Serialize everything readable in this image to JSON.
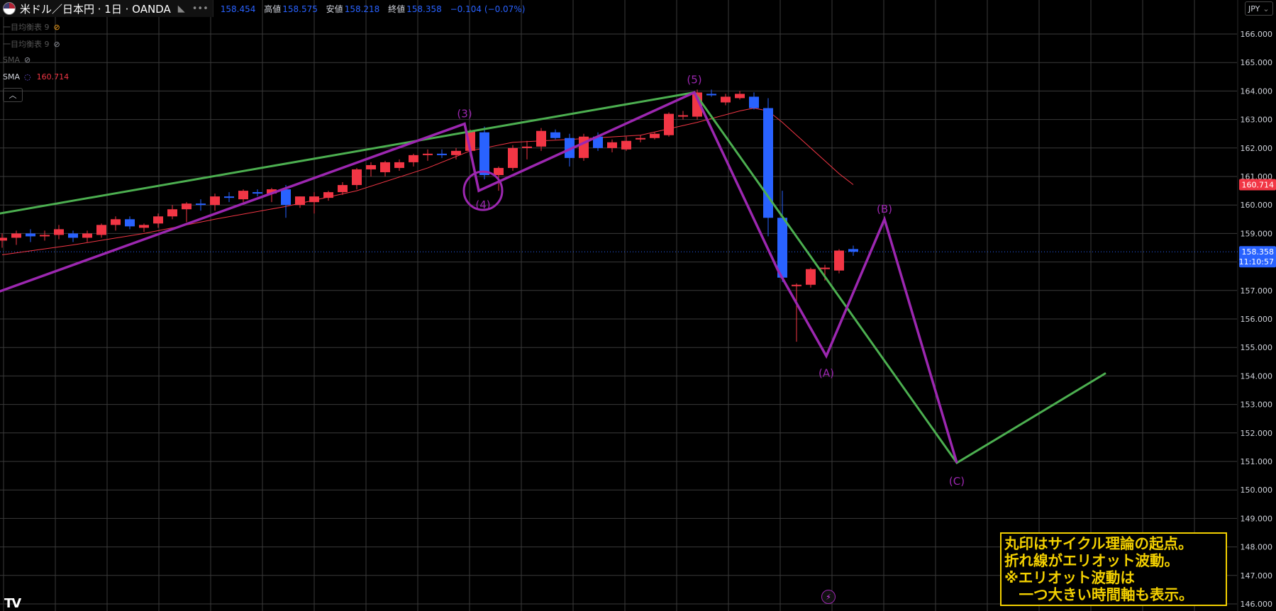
{
  "header": {
    "symbol": "米ドル／日本円 · 1日 · OANDA",
    "ohlc": [
      {
        "key": "",
        "value": "158.454"
      },
      {
        "key": "高値",
        "value": "158.575"
      },
      {
        "key": "安値",
        "value": "158.218"
      },
      {
        "key": "終値",
        "value": "158.358"
      },
      {
        "key": "",
        "value": "−0.104 (−0.07%)"
      }
    ],
    "currency_button": "JPY"
  },
  "indicators": [
    {
      "name": "一目均衡表 9",
      "value": "",
      "color": "#f7a21b",
      "visible": false
    },
    {
      "name": "一目均衡表 9",
      "value": "",
      "color": "#9598a1",
      "visible": false
    },
    {
      "name": "SMA",
      "value": "",
      "color": "#9598a1",
      "visible": false
    },
    {
      "name": "SMA",
      "value": "160.714",
      "color": "#f23645",
      "visible": true
    }
  ],
  "note": {
    "lines": [
      "丸印はサイクル理論の起点。",
      "折れ線がエリオット波動。",
      "※エリオット波動は",
      "　一つ大きい時間軸も表示。"
    ]
  },
  "colors": {
    "up": "#f23645",
    "down": "#2962ff",
    "elliott": "#9c27b0",
    "trend": "#4caf50",
    "sma": "#f23645",
    "note": "#f3d000"
  },
  "chart_data": {
    "type": "candlestick",
    "title": "米ドル／日本円 · 1日 · OANDA",
    "ylim": [
      146.0,
      166.0
    ],
    "y_ticks": [
      "166.000",
      "165.000",
      "164.000",
      "163.000",
      "162.000",
      "161.000",
      "160.000",
      "159.000",
      "158.000",
      "157.000",
      "156.000",
      "155.000",
      "154.000",
      "153.000",
      "152.000",
      "151.000",
      "150.000",
      "149.000",
      "148.000",
      "147.000",
      "146.000"
    ],
    "price_labels": [
      {
        "text": "160.714",
        "value": 160.714,
        "color": "#f23645"
      },
      {
        "text": "158.358",
        "value": 158.358,
        "color": "#2962ff",
        "sub": "11:10:57"
      }
    ],
    "candles": [
      {
        "x": 0,
        "o": 158.75,
        "h": 159.0,
        "l": 158.5,
        "c": 158.85
      },
      {
        "x": 1,
        "o": 158.85,
        "h": 159.1,
        "l": 158.6,
        "c": 159.0
      },
      {
        "x": 2,
        "o": 159.0,
        "h": 159.15,
        "l": 158.7,
        "c": 158.9
      },
      {
        "x": 3,
        "o": 158.9,
        "h": 159.1,
        "l": 158.75,
        "c": 158.95
      },
      {
        "x": 4,
        "o": 158.95,
        "h": 159.3,
        "l": 158.8,
        "c": 159.15
      },
      {
        "x": 5,
        "o": 159.0,
        "h": 159.1,
        "l": 158.7,
        "c": 158.85
      },
      {
        "x": 6,
        "o": 158.85,
        "h": 159.1,
        "l": 158.7,
        "c": 159.0
      },
      {
        "x": 7,
        "o": 158.95,
        "h": 159.35,
        "l": 158.85,
        "c": 159.3
      },
      {
        "x": 8,
        "o": 159.3,
        "h": 159.6,
        "l": 159.1,
        "c": 159.5
      },
      {
        "x": 9,
        "o": 159.5,
        "h": 159.6,
        "l": 159.15,
        "c": 159.25
      },
      {
        "x": 10,
        "o": 159.2,
        "h": 159.35,
        "l": 159.05,
        "c": 159.3
      },
      {
        "x": 11,
        "o": 159.35,
        "h": 159.7,
        "l": 159.2,
        "c": 159.6
      },
      {
        "x": 12,
        "o": 159.6,
        "h": 160.0,
        "l": 159.5,
        "c": 159.85
      },
      {
        "x": 13,
        "o": 159.85,
        "h": 160.1,
        "l": 159.4,
        "c": 160.05
      },
      {
        "x": 14,
        "o": 160.05,
        "h": 160.2,
        "l": 159.8,
        "c": 160.0
      },
      {
        "x": 15,
        "o": 160.0,
        "h": 160.4,
        "l": 159.8,
        "c": 160.3
      },
      {
        "x": 16,
        "o": 160.3,
        "h": 160.45,
        "l": 160.1,
        "c": 160.25
      },
      {
        "x": 17,
        "o": 160.2,
        "h": 160.55,
        "l": 160.1,
        "c": 160.5
      },
      {
        "x": 18,
        "o": 160.45,
        "h": 160.55,
        "l": 160.3,
        "c": 160.4
      },
      {
        "x": 19,
        "o": 160.4,
        "h": 160.6,
        "l": 160.1,
        "c": 160.55
      },
      {
        "x": 20,
        "o": 160.55,
        "h": 160.7,
        "l": 159.55,
        "c": 160.0
      },
      {
        "x": 21,
        "o": 160.0,
        "h": 160.3,
        "l": 159.9,
        "c": 160.3
      },
      {
        "x": 22,
        "o": 160.1,
        "h": 160.45,
        "l": 159.7,
        "c": 160.3
      },
      {
        "x": 23,
        "o": 160.25,
        "h": 160.5,
        "l": 160.15,
        "c": 160.45
      },
      {
        "x": 24,
        "o": 160.45,
        "h": 160.8,
        "l": 160.35,
        "c": 160.7
      },
      {
        "x": 25,
        "o": 160.7,
        "h": 161.3,
        "l": 160.55,
        "c": 161.25
      },
      {
        "x": 26,
        "o": 161.25,
        "h": 161.5,
        "l": 161.0,
        "c": 161.4
      },
      {
        "x": 27,
        "o": 161.15,
        "h": 161.55,
        "l": 161.0,
        "c": 161.5
      },
      {
        "x": 28,
        "o": 161.3,
        "h": 161.6,
        "l": 161.2,
        "c": 161.5
      },
      {
        "x": 29,
        "o": 161.5,
        "h": 161.8,
        "l": 161.35,
        "c": 161.75
      },
      {
        "x": 30,
        "o": 161.75,
        "h": 161.95,
        "l": 161.55,
        "c": 161.8
      },
      {
        "x": 31,
        "o": 161.8,
        "h": 161.95,
        "l": 161.65,
        "c": 161.75
      },
      {
        "x": 32,
        "o": 161.75,
        "h": 162.0,
        "l": 161.6,
        "c": 161.9
      },
      {
        "x": 33,
        "o": 161.9,
        "h": 162.65,
        "l": 161.85,
        "c": 162.6
      },
      {
        "x": 34,
        "o": 162.55,
        "h": 162.75,
        "l": 160.9,
        "c": 161.05
      },
      {
        "x": 35,
        "o": 161.05,
        "h": 161.35,
        "l": 160.5,
        "c": 161.3
      },
      {
        "x": 36,
        "o": 161.3,
        "h": 162.1,
        "l": 161.2,
        "c": 162.0
      },
      {
        "x": 37,
        "o": 162.0,
        "h": 162.25,
        "l": 161.6,
        "c": 162.05
      },
      {
        "x": 38,
        "o": 162.05,
        "h": 162.7,
        "l": 161.9,
        "c": 162.6
      },
      {
        "x": 39,
        "o": 162.55,
        "h": 162.65,
        "l": 162.3,
        "c": 162.35
      },
      {
        "x": 40,
        "o": 162.35,
        "h": 162.5,
        "l": 161.35,
        "c": 161.65
      },
      {
        "x": 41,
        "o": 161.65,
        "h": 162.5,
        "l": 161.55,
        "c": 162.4
      },
      {
        "x": 42,
        "o": 162.4,
        "h": 162.55,
        "l": 161.9,
        "c": 162.0
      },
      {
        "x": 43,
        "o": 162.0,
        "h": 162.3,
        "l": 161.85,
        "c": 162.2
      },
      {
        "x": 44,
        "o": 161.95,
        "h": 162.4,
        "l": 161.9,
        "c": 162.25
      },
      {
        "x": 45,
        "o": 162.3,
        "h": 162.45,
        "l": 162.2,
        "c": 162.35
      },
      {
        "x": 46,
        "o": 162.35,
        "h": 162.55,
        "l": 162.3,
        "c": 162.5
      },
      {
        "x": 47,
        "o": 162.45,
        "h": 163.25,
        "l": 162.4,
        "c": 163.2
      },
      {
        "x": 48,
        "o": 163.1,
        "h": 163.3,
        "l": 163.0,
        "c": 163.15
      },
      {
        "x": 49,
        "o": 163.1,
        "h": 164.05,
        "l": 163.0,
        "c": 163.95
      },
      {
        "x": 50,
        "o": 163.9,
        "h": 164.05,
        "l": 163.8,
        "c": 163.85
      },
      {
        "x": 51,
        "o": 163.6,
        "h": 163.9,
        "l": 163.5,
        "c": 163.8
      },
      {
        "x": 52,
        "o": 163.75,
        "h": 164.0,
        "l": 163.7,
        "c": 163.9
      },
      {
        "x": 53,
        "o": 163.8,
        "h": 163.95,
        "l": 163.35,
        "c": 163.4
      },
      {
        "x": 54,
        "o": 163.4,
        "h": 163.75,
        "l": 158.9,
        "c": 159.55
      },
      {
        "x": 55,
        "o": 159.55,
        "h": 160.5,
        "l": 157.3,
        "c": 157.45
      },
      {
        "x": 56,
        "o": 157.15,
        "h": 157.25,
        "l": 155.2,
        "c": 157.2
      },
      {
        "x": 57,
        "o": 157.2,
        "h": 157.8,
        "l": 157.1,
        "c": 157.75
      },
      {
        "x": 58,
        "o": 157.75,
        "h": 157.9,
        "l": 157.35,
        "c": 157.8
      },
      {
        "x": 59,
        "o": 157.7,
        "h": 158.45,
        "l": 157.6,
        "c": 158.4
      },
      {
        "x": 60,
        "o": 158.454,
        "h": 158.575,
        "l": 158.218,
        "c": 158.358
      }
    ],
    "sma": [
      [
        0,
        158.25
      ],
      [
        5,
        158.6
      ],
      [
        10,
        159.0
      ],
      [
        15,
        159.5
      ],
      [
        20,
        159.95
      ],
      [
        25,
        160.5
      ],
      [
        30,
        161.3
      ],
      [
        33,
        161.9
      ],
      [
        36,
        162.2
      ],
      [
        40,
        162.3
      ],
      [
        45,
        162.45
      ],
      [
        49,
        162.9
      ],
      [
        52,
        163.3
      ],
      [
        53,
        163.4
      ],
      [
        54,
        163.3
      ],
      [
        55,
        162.9
      ],
      [
        56,
        162.45
      ],
      [
        57,
        162.0
      ],
      [
        58,
        161.55
      ],
      [
        59,
        161.1
      ],
      [
        60,
        160.714
      ]
    ],
    "elliott_wave": [
      [
        -2.5,
        156.55
      ],
      [
        32.6,
        162.85
      ],
      [
        33.6,
        160.5
      ],
      [
        48.8,
        163.95
      ],
      [
        54.7,
        157.7
      ],
      [
        58.1,
        154.7
      ],
      [
        62.2,
        159.5
      ],
      [
        67.3,
        150.95
      ]
    ],
    "trend_line": [
      [
        -2.5,
        159.5
      ],
      [
        48.8,
        163.95
      ],
      [
        67.3,
        150.95
      ],
      [
        77.8,
        154.1
      ]
    ],
    "wave_labels": [
      {
        "text": "(3)",
        "x": 32.6,
        "y": 163.2
      },
      {
        "text": "(4)",
        "x": 33.9,
        "y": 160.0
      },
      {
        "text": "(5)",
        "x": 48.8,
        "y": 164.4
      },
      {
        "text": "(A)",
        "x": 58.1,
        "y": 154.1
      },
      {
        "text": "(B)",
        "x": 62.2,
        "y": 159.85
      },
      {
        "text": "(C)",
        "x": 67.3,
        "y": 150.3
      }
    ],
    "cycle_circle": {
      "x": 33.9,
      "y": 160.5
    },
    "grid": true
  }
}
